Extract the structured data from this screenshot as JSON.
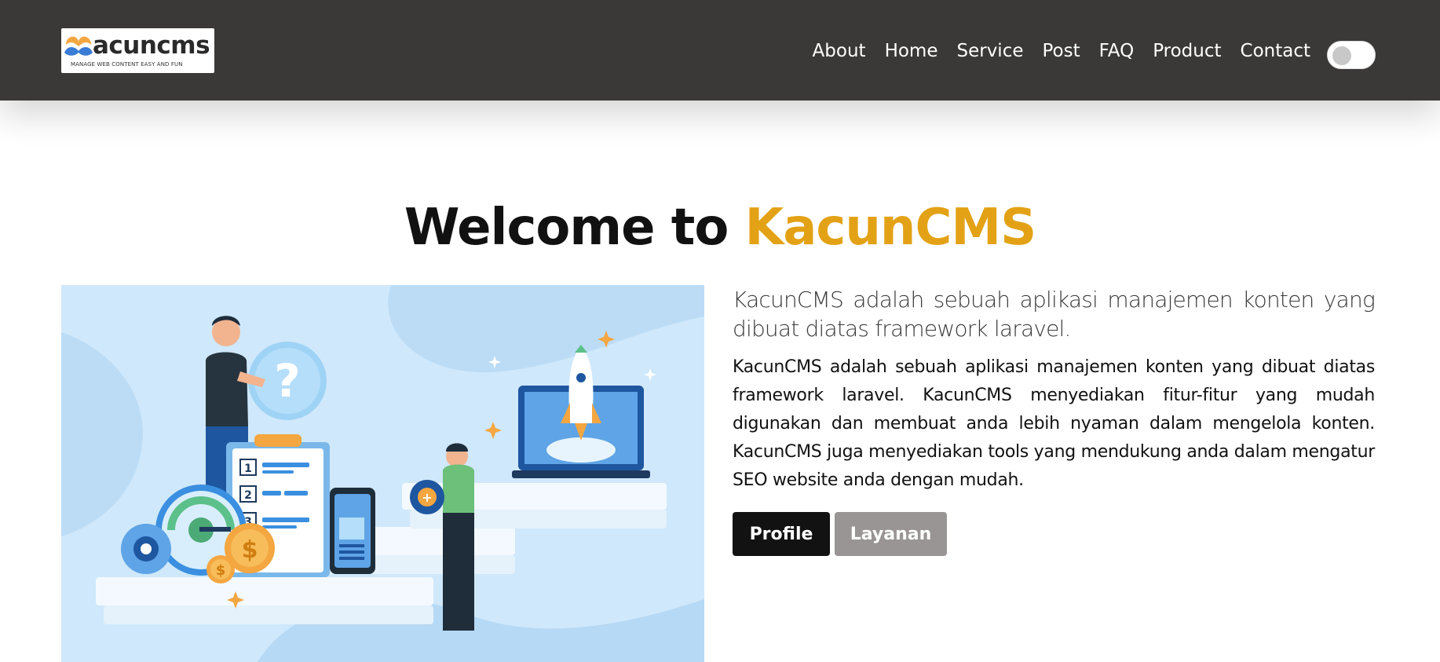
{
  "header": {
    "logo": {
      "wordmark": "acuncms",
      "tagline": "MANAGE WEB CONTENT EASY AND FUN",
      "colors": {
        "orange": "#f4a640",
        "blue": "#3a7bd5"
      }
    },
    "nav": [
      {
        "label": "About"
      },
      {
        "label": "Home"
      },
      {
        "label": "Service"
      },
      {
        "label": "Post"
      },
      {
        "label": "FAQ"
      },
      {
        "label": "Product"
      },
      {
        "label": "Contact"
      }
    ],
    "theme_toggle": {
      "state": "off"
    },
    "background": "#3a3938"
  },
  "hero": {
    "heading_prefix": "Welcome to",
    "heading_brand": "KacunCMS",
    "brand_color": "#e3a216",
    "lead": "KacunCMS adalah sebuah aplikasi manajemen konten yang dibuat diatas framework laravel.",
    "body": "KacunCMS adalah sebuah aplikasi manajemen konten yang dibuat diatas framework laravel. KacunCMS menyediakan fitur-fitur yang mudah digunakan dan membuat anda lebih nyaman dalam mengelola konten. KacunCMS juga menyediakan tools yang mendukung anda dalam mengatur SEO website anda dengan mudah.",
    "buttons": {
      "profile": "Profile",
      "layanan": "Layanan"
    },
    "illustration": {
      "question_mark": "?",
      "checklist_numbers": [
        "1",
        "2",
        "3"
      ],
      "coin_symbol": "$",
      "gear_symbol": "+"
    }
  }
}
